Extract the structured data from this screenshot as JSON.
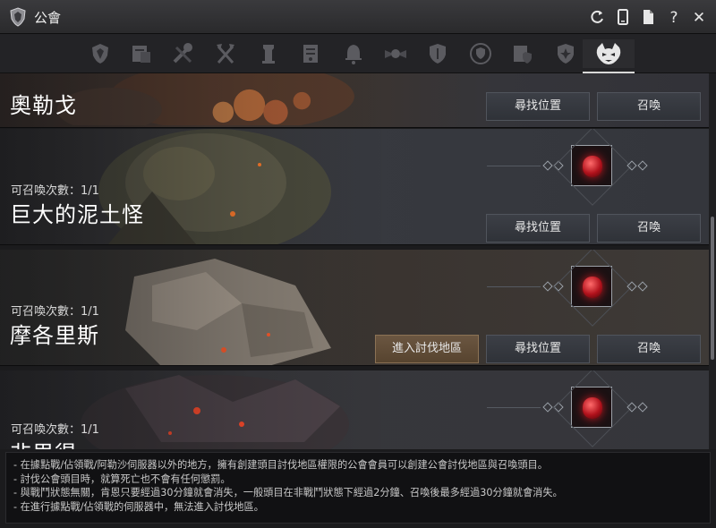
{
  "window": {
    "title": "公會",
    "controls": [
      {
        "name": "refresh-icon",
        "glyph": "⟳"
      },
      {
        "name": "phone-icon",
        "glyph": "▯"
      },
      {
        "name": "document-icon",
        "glyph": "▤"
      },
      {
        "name": "help-icon",
        "glyph": "?"
      },
      {
        "name": "close-icon",
        "glyph": "✕"
      }
    ]
  },
  "tabs": [
    {
      "name": "guild-crest-icon"
    },
    {
      "name": "notice-board-icon"
    },
    {
      "name": "crossed-tools-icon"
    },
    {
      "name": "crossed-axes-icon"
    },
    {
      "name": "tower-icon"
    },
    {
      "name": "scroll-icon"
    },
    {
      "name": "bell-icon"
    },
    {
      "name": "winged-emblem-icon"
    },
    {
      "name": "shield-icon"
    },
    {
      "name": "round-shield-icon"
    },
    {
      "name": "document-shield-icon"
    },
    {
      "name": "fleur-shield-icon"
    },
    {
      "name": "demon-mask-icon",
      "active": true
    }
  ],
  "bosses": [
    {
      "name": "奧勒戈",
      "count_label": "",
      "buttons": {
        "locate": "尋找位置",
        "summon": "召喚"
      }
    },
    {
      "name": "巨大的泥土怪",
      "count_label": "可召喚次數：1/1",
      "buttons": {
        "locate": "尋找位置",
        "summon": "召喚"
      }
    },
    {
      "name": "摩各里斯",
      "count_label": "可召喚次數：1/1",
      "buttons": {
        "enter": "進入討伐地區",
        "locate": "尋找位置",
        "summon": "召喚"
      }
    },
    {
      "name": "非里得",
      "count_label": "可召喚次數：1/1",
      "buttons": {}
    }
  ],
  "notes": [
    "- 在據點戰/佔領戰/阿勒沙伺服器以外的地方，擁有創建頭目討伐地區權限的公會會員可以創建公會討伐地區與召喚頭目。",
    "- 討伐公會頭目時，就算死亡也不會有任何懲罰。",
    "- 與戰鬥狀態無關，肯恩只要經過30分鐘就會消失，一般頭目在非戰鬥狀態下經過2分鐘、召喚後最多經過30分鐘就會消失。",
    "- 在進行據點戰/佔領戰的伺服器中，無法進入討伐地區。"
  ],
  "colors": {
    "accent_gem": "#c41a22",
    "gold_button": "#6b5641",
    "button": "#3c3f46"
  }
}
